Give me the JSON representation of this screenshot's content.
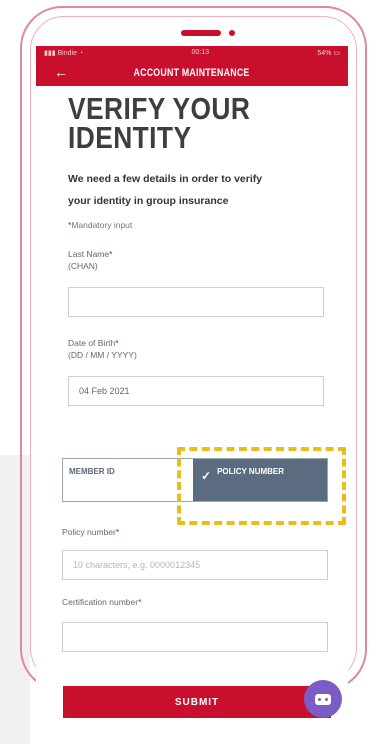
{
  "statusbar": {
    "carrier": "Bindie",
    "time": "00:13",
    "battery": "54%"
  },
  "navbar": {
    "back_icon": "back-arrow-icon",
    "title": "ACCOUNT MAINTENANCE"
  },
  "page": {
    "title_line1": "VERIFY YOUR",
    "title_line2": "IDENTITY",
    "intro_line1": "We need a few details in order to verify",
    "intro_line2": "your identity in group insurance",
    "mandatory_note": "Mandatory input"
  },
  "form": {
    "last_name": {
      "label": "Last Name",
      "hint": "(CHAN)",
      "value": ""
    },
    "dob": {
      "label": "Date of Birth",
      "hint": "(DD / MM / YYYY)",
      "value": "04 Feb 2021"
    },
    "toggle": {
      "left_label": "MEMBER ID",
      "right_label": "POLICY NUMBER",
      "selected": "POLICY NUMBER"
    },
    "policy_number": {
      "label": "Policy number",
      "placeholder": "10 characters, e.g. 0000012345",
      "value": ""
    },
    "certification_number": {
      "label": "Certification number",
      "value": ""
    },
    "submit_label": "SUBMIT"
  },
  "colors": {
    "brand_red": "#c8102e",
    "toggle_selected": "#5c6c80",
    "highlight": "#e9bd1a",
    "chat_purple": "#7b5cc7"
  }
}
